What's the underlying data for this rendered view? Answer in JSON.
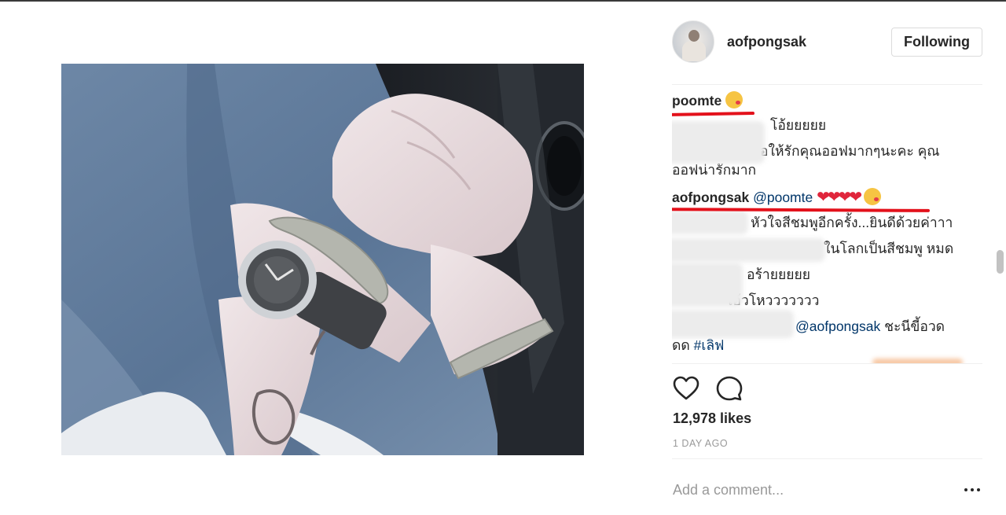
{
  "post": {
    "author": "aofpongsak",
    "follow_label": "Following",
    "likes": "12,978 likes",
    "time": "1 DAY AGO",
    "comment_placeholder": "Add a comment...",
    "more_label": "•••"
  },
  "comments": [
    {
      "user": "poomte",
      "text": ""
    },
    {
      "text": "โอ้ยยยยย"
    },
    {
      "text": "ขอให้รักคุณออฟมากๆนะคะ คุณ"
    },
    {
      "text": "ออฟน่ารักมาก"
    },
    {
      "user": "aofpongsak",
      "mention": "@poomte"
    },
    {
      "text": "หัวใจสีชมพูอีกครั้ง...ยินดีด้วยค่าาา"
    },
    {
      "text": "ในโลกเป็นสีชมพู หมด"
    },
    {
      "text": "อร้ายยยยย"
    },
    {
      "text": "โอ้วโหววววววว"
    },
    {
      "mention": "@aofpongsak",
      "text": "ชะนีขี้อวด"
    },
    {
      "text": "ดด",
      "hashtag": "#เลิฟ"
    }
  ],
  "colors": {
    "accent_link": "#003569",
    "redaction_mark": "#e3111b",
    "heart": "#e0253b"
  },
  "icons": [
    "heart-outline-icon",
    "comment-bubble-icon",
    "more-dots-icon"
  ]
}
